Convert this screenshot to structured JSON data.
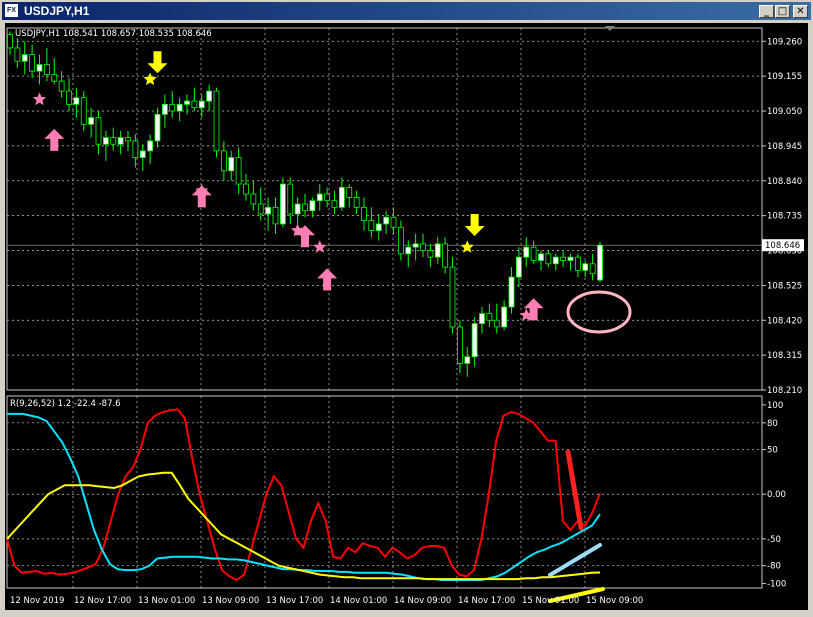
{
  "window": {
    "title": "USDJPY,H1",
    "app_icon": "chart-window-icon",
    "buttons": [
      {
        "name": "minimize-button",
        "glyph": "_"
      },
      {
        "name": "restore-button",
        "glyph": "□"
      },
      {
        "name": "close-button",
        "glyph": "✕"
      }
    ]
  },
  "price_panel": {
    "header": "USDJPY,H1  108.541 108.657 108.535 108.646",
    "current_price": "108.646",
    "price_ticks": [
      {
        "label": "109.260",
        "v": 109.26
      },
      {
        "label": "109.155",
        "v": 109.155
      },
      {
        "label": "109.050",
        "v": 109.05
      },
      {
        "label": "108.945",
        "v": 108.945
      },
      {
        "label": "108.840",
        "v": 108.84
      },
      {
        "label": "108.735",
        "v": 108.735
      },
      {
        "label": "108.630",
        "v": 108.63
      },
      {
        "label": "108.525",
        "v": 108.525
      },
      {
        "label": "108.420",
        "v": 108.42
      },
      {
        "label": "108.315",
        "v": 108.315
      },
      {
        "label": "108.210",
        "v": 108.21
      }
    ]
  },
  "indicator_panel": {
    "header": "R(9,26,52) 1.2 -22.4 -87.6",
    "ticks": [
      {
        "label": "100",
        "v": 100
      },
      {
        "label": "80",
        "v": 80
      },
      {
        "label": "50",
        "v": 50
      },
      {
        "label": "0.00",
        "v": 0
      },
      {
        "label": "-50",
        "v": -50
      },
      {
        "label": "-80",
        "v": -80
      },
      {
        "label": "-100",
        "v": -100
      }
    ]
  },
  "time_axis": [
    "12 Nov 2019",
    "12 Nov 17:00",
    "13 Nov 01:00",
    "13 Nov 09:00",
    "13 Nov 17:00",
    "14 Nov 01:00",
    "14 Nov 09:00",
    "14 Nov 17:00",
    "15 Nov 01:00",
    "15 Nov 09:00"
  ],
  "colors": {
    "background": "#000000",
    "bull_candle": "#ffffff",
    "bear_candle": "#000000",
    "wick": "#00ff00",
    "grid": "#c8c8c8",
    "buy_arrow": "#ff7fb5",
    "sell_arrow": "#ffff00",
    "rci_short": "#ff0000",
    "rci_mid": "#00e5ff",
    "rci_long": "#ffff00"
  },
  "chart_data": [
    {
      "type": "candlestick",
      "symbol": "USDJPY",
      "timeframe": "H1",
      "ylim": [
        108.21,
        109.3
      ],
      "candles": [
        [
          109.28,
          109.29,
          109.22,
          109.24
        ],
        [
          109.24,
          109.27,
          109.18,
          109.2
        ],
        [
          109.2,
          109.26,
          109.16,
          109.22
        ],
        [
          109.22,
          109.25,
          109.15,
          109.17
        ],
        [
          109.17,
          109.22,
          109.13,
          109.19
        ],
        [
          109.19,
          109.24,
          109.14,
          109.16
        ],
        [
          109.16,
          109.21,
          109.13,
          109.14
        ],
        [
          109.14,
          109.17,
          109.09,
          109.11
        ],
        [
          109.11,
          109.15,
          109.05,
          109.07
        ],
        [
          109.07,
          109.12,
          109.03,
          109.09
        ],
        [
          109.09,
          109.11,
          108.99,
          109.01
        ],
        [
          109.01,
          109.06,
          108.97,
          109.03
        ],
        [
          109.03,
          109.05,
          108.92,
          108.95
        ],
        [
          108.95,
          108.99,
          108.9,
          108.97
        ],
        [
          108.97,
          109.0,
          108.93,
          108.95
        ],
        [
          108.95,
          108.99,
          108.92,
          108.97
        ],
        [
          108.97,
          108.99,
          108.93,
          108.96
        ],
        [
          108.96,
          108.98,
          108.88,
          108.91
        ],
        [
          108.91,
          108.95,
          108.87,
          108.93
        ],
        [
          108.93,
          108.98,
          108.89,
          108.96
        ],
        [
          108.96,
          109.06,
          108.94,
          109.04
        ],
        [
          109.04,
          109.1,
          109.0,
          109.07
        ],
        [
          109.07,
          109.11,
          109.03,
          109.05
        ],
        [
          109.05,
          109.09,
          109.02,
          109.07
        ],
        [
          109.07,
          109.1,
          109.04,
          109.08
        ],
        [
          109.08,
          109.12,
          109.05,
          109.06
        ],
        [
          109.06,
          109.1,
          109.03,
          109.08
        ],
        [
          109.08,
          109.13,
          109.05,
          109.11
        ],
        [
          109.11,
          109.12,
          108.91,
          108.93
        ],
        [
          108.93,
          108.96,
          108.84,
          108.87
        ],
        [
          108.87,
          108.93,
          108.84,
          108.91
        ],
        [
          108.91,
          108.94,
          108.8,
          108.83
        ],
        [
          108.83,
          108.86,
          108.78,
          108.8
        ],
        [
          108.8,
          108.84,
          108.75,
          108.77
        ],
        [
          108.77,
          108.82,
          108.72,
          108.74
        ],
        [
          108.74,
          108.79,
          108.69,
          108.76
        ],
        [
          108.76,
          108.79,
          108.68,
          108.71
        ],
        [
          108.71,
          108.85,
          108.7,
          108.83
        ],
        [
          108.83,
          108.85,
          108.71,
          108.74
        ],
        [
          108.74,
          108.79,
          108.71,
          108.77
        ],
        [
          108.77,
          108.8,
          108.73,
          108.75
        ],
        [
          108.75,
          108.79,
          108.73,
          108.78
        ],
        [
          108.78,
          108.83,
          108.75,
          108.8
        ],
        [
          108.8,
          108.82,
          108.76,
          108.78
        ],
        [
          108.78,
          108.81,
          108.74,
          108.76
        ],
        [
          108.76,
          108.85,
          108.75,
          108.82
        ],
        [
          108.82,
          108.83,
          108.76,
          108.79
        ],
        [
          108.79,
          108.81,
          108.74,
          108.76
        ],
        [
          108.76,
          108.79,
          108.69,
          108.72
        ],
        [
          108.72,
          108.76,
          108.67,
          108.69
        ],
        [
          108.69,
          108.74,
          108.66,
          108.71
        ],
        [
          108.71,
          108.75,
          108.68,
          108.73
        ],
        [
          108.73,
          108.76,
          108.68,
          108.7
        ],
        [
          108.7,
          108.72,
          108.6,
          108.62
        ],
        [
          108.62,
          108.66,
          108.58,
          108.64
        ],
        [
          108.64,
          108.68,
          108.6,
          108.65
        ],
        [
          108.65,
          108.68,
          108.61,
          108.63
        ],
        [
          108.63,
          108.65,
          108.58,
          108.61
        ],
        [
          108.61,
          108.67,
          108.59,
          108.65
        ],
        [
          108.65,
          108.67,
          108.56,
          108.58
        ],
        [
          108.58,
          108.61,
          108.38,
          108.4
        ],
        [
          108.4,
          108.42,
          108.26,
          108.29
        ],
        [
          108.29,
          108.34,
          108.25,
          108.31
        ],
        [
          108.31,
          108.43,
          108.28,
          108.41
        ],
        [
          108.41,
          108.46,
          108.38,
          108.44
        ],
        [
          108.44,
          108.47,
          108.4,
          108.42
        ],
        [
          108.42,
          108.47,
          108.38,
          108.4
        ],
        [
          108.4,
          108.48,
          108.39,
          108.46
        ],
        [
          108.46,
          108.58,
          108.44,
          108.55
        ],
        [
          108.55,
          108.64,
          108.52,
          108.61
        ],
        [
          108.61,
          108.67,
          108.58,
          108.64
        ],
        [
          108.64,
          108.66,
          108.59,
          108.6
        ],
        [
          108.6,
          108.63,
          108.57,
          108.62
        ],
        [
          108.62,
          108.63,
          108.58,
          108.59
        ],
        [
          108.59,
          108.62,
          108.57,
          108.61
        ],
        [
          108.61,
          108.63,
          108.58,
          108.6
        ],
        [
          108.6,
          108.62,
          108.57,
          108.61
        ],
        [
          108.61,
          108.62,
          108.55,
          108.57
        ],
        [
          108.57,
          108.6,
          108.55,
          108.59
        ],
        [
          108.59,
          108.62,
          108.54,
          108.56
        ],
        [
          108.541,
          108.657,
          108.535,
          108.646
        ]
      ],
      "signals": [
        {
          "type": "buy-arrow",
          "i": 6,
          "price": 108.96
        },
        {
          "type": "buy-star",
          "i": 4,
          "price": 109.085
        },
        {
          "type": "sell-arrow",
          "i": 20,
          "price": 109.2
        },
        {
          "type": "sell-star",
          "i": 19,
          "price": 109.145
        },
        {
          "type": "buy-arrow",
          "i": 26,
          "price": 108.79
        },
        {
          "type": "buy-star",
          "i": 26,
          "price": 108.81
        },
        {
          "type": "buy-arrow",
          "i": 40,
          "price": 108.67
        },
        {
          "type": "buy-star",
          "i": 39,
          "price": 108.69
        },
        {
          "type": "buy-star",
          "i": 42,
          "price": 108.64
        },
        {
          "type": "buy-arrow",
          "i": 43,
          "price": 108.54
        },
        {
          "type": "sell-arrow",
          "i": 63,
          "price": 108.71
        },
        {
          "type": "sell-star",
          "i": 62,
          "price": 108.64
        },
        {
          "type": "buy-arrow",
          "i": 71,
          "price": 108.45
        },
        {
          "type": "buy-star",
          "i": 70,
          "price": 108.435
        }
      ]
    },
    {
      "type": "line",
      "title": "R(9,26,52)",
      "ylim": [
        -105,
        110
      ],
      "series": [
        {
          "color": "#ff0000",
          "values": [
            -50,
            -80,
            -88,
            -87,
            -86,
            -89,
            -88,
            -90,
            -89,
            -88,
            -85,
            -82,
            -78,
            -60,
            -30,
            0,
            20,
            30,
            50,
            80,
            88,
            92,
            94,
            95,
            85,
            40,
            0,
            -30,
            -60,
            -85,
            -92,
            -96,
            -90,
            -60,
            -30,
            0,
            20,
            10,
            -20,
            -50,
            -60,
            -30,
            -10,
            -30,
            -70,
            -72,
            -60,
            -65,
            -55,
            -58,
            -60,
            -70,
            -60,
            -65,
            -72,
            -68,
            -60,
            -58,
            -58,
            -60,
            -80,
            -90,
            -92,
            -85,
            -50,
            0,
            60,
            88,
            92,
            90,
            85,
            80,
            70,
            60,
            60,
            -30,
            -40,
            -30,
            -35,
            -20,
            1.2
          ]
        },
        {
          "color": "#00e5ff",
          "values": [
            90,
            90,
            90,
            88,
            86,
            82,
            70,
            58,
            40,
            20,
            -10,
            -40,
            -62,
            -78,
            -84,
            -85,
            -85,
            -84,
            -80,
            -72,
            -71,
            -70,
            -70,
            -70,
            -70,
            -71,
            -72,
            -72,
            -73,
            -73,
            -74,
            -76,
            -78,
            -80,
            -82,
            -84,
            -84,
            -85,
            -85,
            -86,
            -86,
            -86,
            -87,
            -87,
            -88,
            -88,
            -88,
            -88,
            -88,
            -89,
            -90,
            -92,
            -94,
            -95,
            -95,
            -96,
            -96,
            -96,
            -96,
            -96,
            -96,
            -94,
            -92,
            -88,
            -82,
            -76,
            -70,
            -65,
            -62,
            -58,
            -55,
            -50,
            -45,
            -40,
            -35,
            -22.4
          ]
        },
        {
          "color": "#ffff00",
          "values": [
            -50,
            -40,
            -30,
            -20,
            -10,
            0,
            5,
            10,
            10,
            10,
            10,
            9,
            8,
            7,
            10,
            15,
            20,
            22,
            23,
            24,
            24,
            10,
            -5,
            -15,
            -25,
            -35,
            -45,
            -50,
            -55,
            -60,
            -65,
            -70,
            -75,
            -80,
            -82,
            -84,
            -86,
            -88,
            -90,
            -91,
            -92,
            -93,
            -93,
            -94,
            -94,
            -94,
            -94,
            -94,
            -94,
            -94,
            -94,
            -95,
            -95,
            -95,
            -95,
            -95,
            -95,
            -95,
            -95,
            -95,
            -95,
            -95,
            -95,
            -94,
            -94,
            -93,
            -93,
            -92,
            -91,
            -90,
            -89,
            -88,
            -87.6
          ]
        }
      ]
    }
  ]
}
